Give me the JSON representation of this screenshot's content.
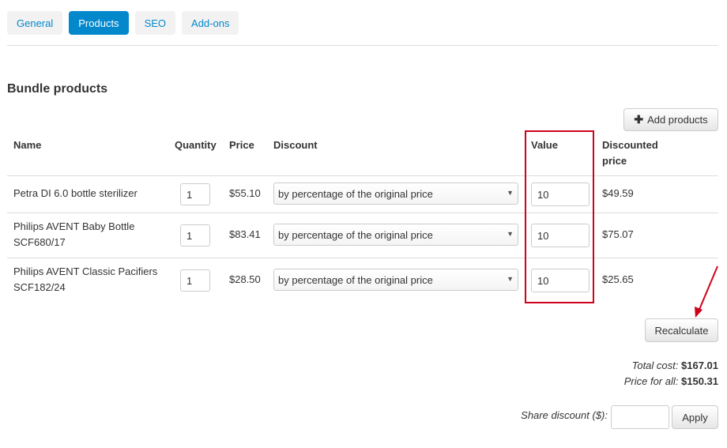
{
  "tabs": [
    {
      "label": "General",
      "active": false
    },
    {
      "label": "Products",
      "active": true
    },
    {
      "label": "SEO",
      "active": false
    },
    {
      "label": "Add-ons",
      "active": false
    }
  ],
  "section_title": "Bundle products",
  "add_products_label": "Add products",
  "columns": {
    "name": "Name",
    "quantity": "Quantity",
    "price": "Price",
    "discount": "Discount",
    "value": "Value",
    "discounted_price_line1": "Discounted",
    "discounted_price_line2": "price"
  },
  "rows": [
    {
      "name_line1": "Petra DI 6.0 bottle sterilizer",
      "name_line2": "",
      "quantity": "1",
      "price": "$55.10",
      "discount": "by percentage of the original price",
      "value": "10",
      "discounted_price": "$49.59"
    },
    {
      "name_line1": "Philips AVENT Baby Bottle",
      "name_line2": "SCF680/17",
      "quantity": "1",
      "price": "$83.41",
      "discount": "by percentage of the original price",
      "value": "10",
      "discounted_price": "$75.07"
    },
    {
      "name_line1": "Philips AVENT Classic Pacifiers",
      "name_line2": "SCF182/24",
      "quantity": "1",
      "price": "$28.50",
      "discount": "by percentage of the original price",
      "value": "10",
      "discounted_price": "$25.65"
    }
  ],
  "recalculate_label": "Recalculate",
  "total_cost_label": "Total cost:",
  "total_cost_value": "$167.01",
  "price_for_all_label": "Price for all:",
  "price_for_all_value": "$150.31",
  "share_discount_label": "Share discount ($):",
  "share_discount_value": "",
  "apply_label": "Apply",
  "colors": {
    "accent": "#0388cc",
    "highlight": "#d0021b"
  }
}
